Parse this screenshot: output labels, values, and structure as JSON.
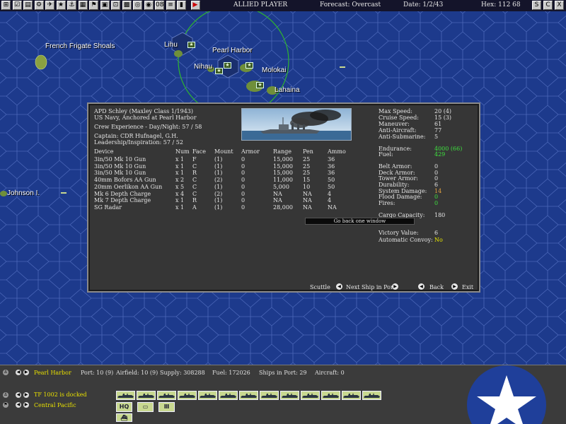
{
  "topbar": {
    "side_label": "ALLIED PLAYER",
    "forecast": "Forecast: Overcast",
    "date": "Date: 1/2/43",
    "hex": "Hex: 112 68",
    "button_glyphs": [
      "⊞",
      "☑",
      "▤",
      "⚙",
      "✈",
      "★",
      "⚓",
      "▦",
      "⚑",
      "▣",
      "⊡",
      "▩",
      "◎",
      "◉",
      "08",
      "≡",
      "▮",
      "▶"
    ],
    "right_buttons": [
      "S",
      "C",
      "X"
    ]
  },
  "map": {
    "places": [
      {
        "name": "French Frigate Shoals"
      },
      {
        "name": "Lihu"
      },
      {
        "name": "Pearl Harbor"
      },
      {
        "name": "Nihau"
      },
      {
        "name": "Molokai"
      },
      {
        "name": "Lahaina"
      },
      {
        "name": "Johnson I."
      }
    ]
  },
  "ship": {
    "name": "APD Schley (Maxley Class 1/1943)",
    "status": "US Navy, Anchored at Pearl Harbor",
    "crew_exp": "Crew Experience - Day/Night: 57 / 58",
    "captain": "Captain: CDR Hufnagel, G.H.",
    "leadership": "Leadership/Inspiration: 57 / 52"
  },
  "devices": {
    "headers": [
      "Device",
      "Num",
      "Face",
      "Mount",
      "Armor",
      "Range",
      "Pen",
      "Ammo"
    ],
    "rows": [
      [
        "3in/50 Mk 10 Gun",
        "x 1",
        "F",
        "(1)",
        "0",
        "15,000",
        "25",
        "36"
      ],
      [
        "3in/50 Mk 10 Gun",
        "x 1",
        "C",
        "(1)",
        "0",
        "15,000",
        "25",
        "36"
      ],
      [
        "3in/50 Mk 10 Gun",
        "x 1",
        "R",
        "(1)",
        "0",
        "15,000",
        "25",
        "36"
      ],
      [
        "40mm Bofors AA Gun",
        "x 2",
        "C",
        "(2)",
        "0",
        "11,000",
        "15",
        "50"
      ],
      [
        "20mm Oerlikon AA Gun",
        "x 5",
        "C",
        "(1)",
        "0",
        "5,000",
        "10",
        "50"
      ],
      [
        "Mk 6 Depth Charge",
        "x 4",
        "C",
        "(2)",
        "0",
        "NA",
        "NA",
        "4"
      ],
      [
        "Mk 7 Depth Charge",
        "x 1",
        "R",
        "(1)",
        "0",
        "NA",
        "NA",
        "4"
      ],
      [
        "SG Radar",
        "x 1",
        "A",
        "(1)",
        "0",
        "28,000",
        "NA",
        "NA"
      ]
    ]
  },
  "stats": [
    {
      "label": "Max Speed:",
      "value": "20 (4)",
      "color": "white"
    },
    {
      "label": "Cruise Speed:",
      "value": "15 (3)",
      "color": "white"
    },
    {
      "label": "Maneuver:",
      "value": "61",
      "color": "white"
    },
    {
      "label": "Anti-Aircraft:",
      "value": "77",
      "color": "white"
    },
    {
      "label": "Anti-Submarine:",
      "value": "5",
      "color": "white"
    },
    {
      "label": "Endurance:",
      "value": "4000 (66)",
      "color": "green"
    },
    {
      "label": "Fuel:",
      "value": "429",
      "color": "green"
    },
    {
      "label": "Belt Armor:",
      "value": "0",
      "color": "white"
    },
    {
      "label": "Deck Armor:",
      "value": "0",
      "color": "white"
    },
    {
      "label": "Tower Armor:",
      "value": "0",
      "color": "white"
    },
    {
      "label": "Durability:",
      "value": "6",
      "color": "white"
    },
    {
      "label": "System Damage:",
      "value": "14",
      "color": "orange"
    },
    {
      "label": "Flood Damage:",
      "value": "0",
      "color": "green"
    },
    {
      "label": "Fires:",
      "value": "0",
      "color": "green"
    },
    {
      "label": "Cargo Capacity:",
      "value": "180",
      "color": "white"
    },
    {
      "label": "Victory Value:",
      "value": "6",
      "color": "white"
    },
    {
      "label": "Automatic Convoy:",
      "value": "No",
      "color": "yellow"
    }
  ],
  "tooltip": "Go back one window",
  "dialog_buttons": {
    "scuttle": "Scuttle",
    "next": "Next Ship in Port",
    "back": "Back",
    "exit": "Exit"
  },
  "bottom": {
    "base_name": "Pearl Harbor",
    "port": "Port: 10 (9)",
    "airfield": "Airfield: 10 (9)",
    "supply": "Supply: 308288",
    "fuel": "Fuel: 172026",
    "ships": "Ships in Port: 29",
    "aircraft": "Aircraft: 0",
    "tf_status": "TF 1002 is docked",
    "region": "Central Pacific",
    "hq_label": "HQ"
  },
  "colors": {
    "ocean": "#1d3a8c",
    "dialog_bg": "#363636",
    "stat_green": "#3ee03e",
    "stat_orange": "#e0a040",
    "status_yellow": "#e8e000",
    "insignia_blue": "#1f3f9a"
  }
}
